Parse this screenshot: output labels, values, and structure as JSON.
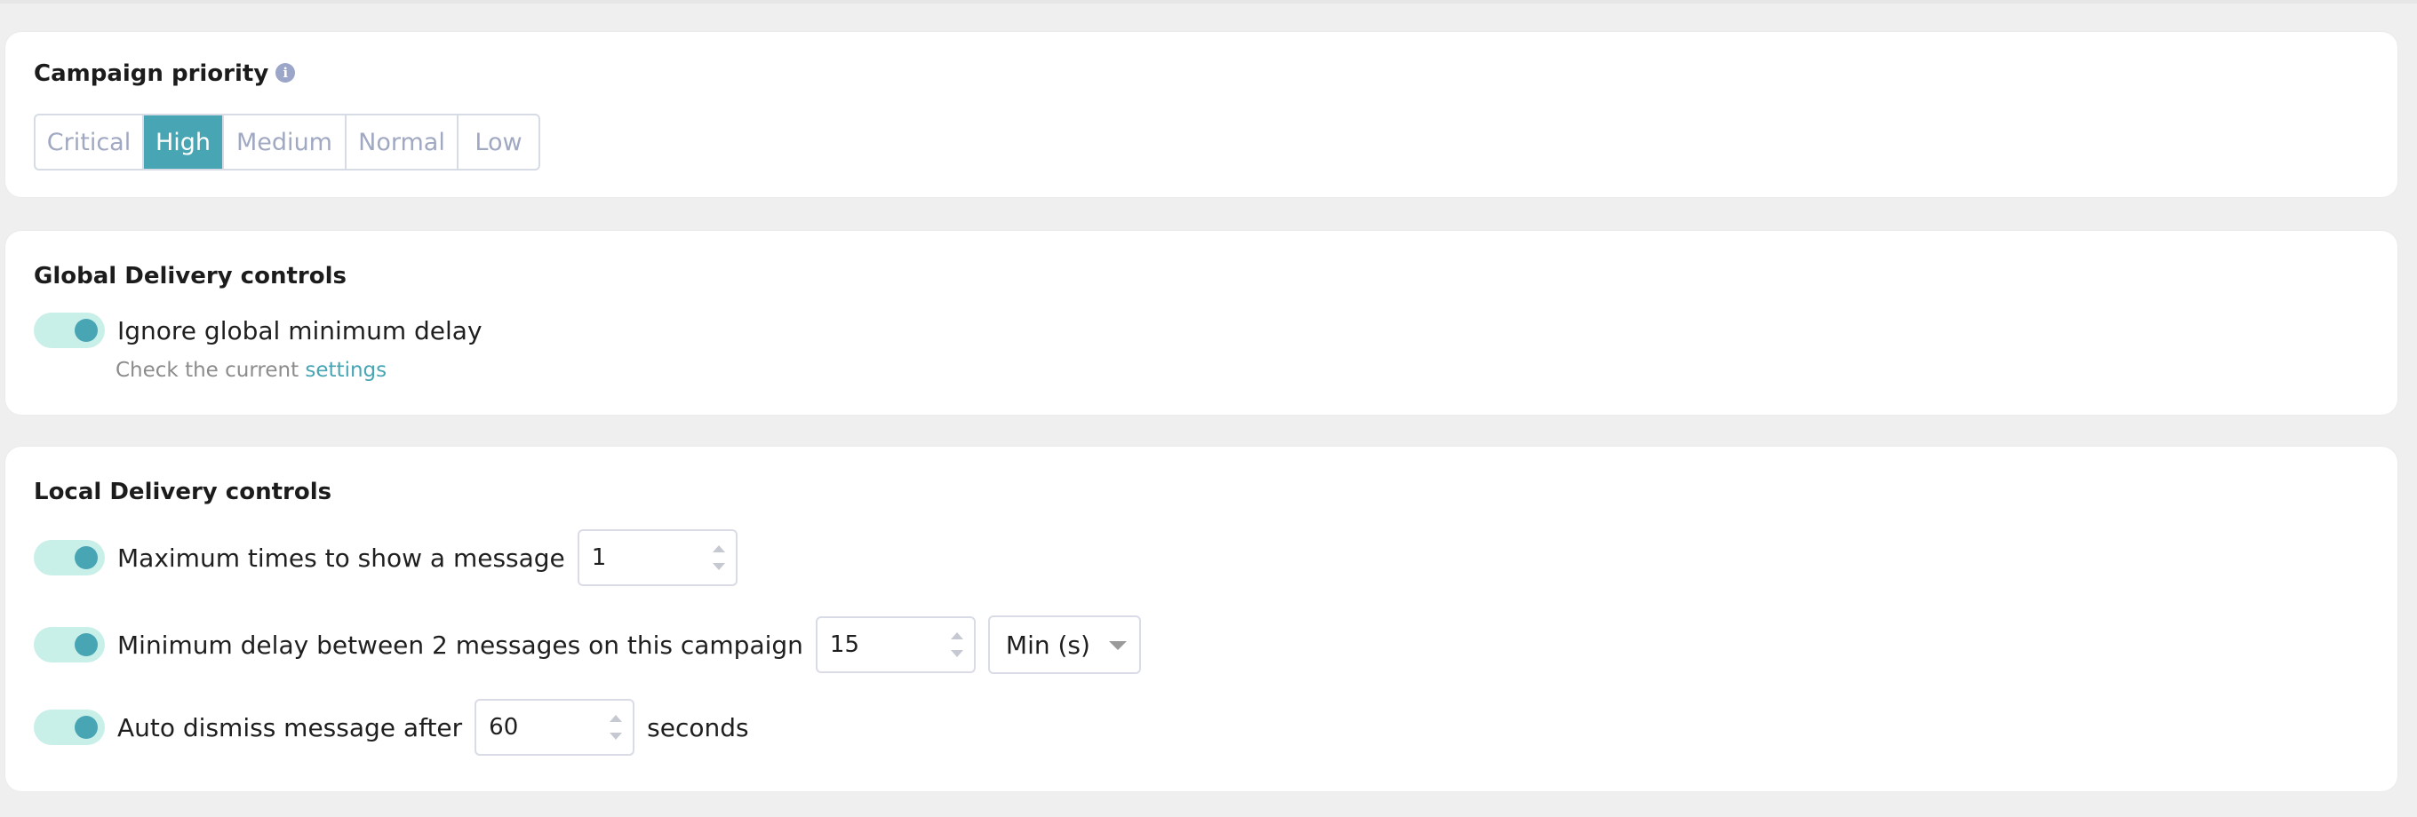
{
  "priority": {
    "title": "Campaign priority",
    "info_glyph": "i",
    "options": [
      "Critical",
      "High",
      "Medium",
      "Normal",
      "Low"
    ],
    "selected": "High"
  },
  "global": {
    "title": "Global Delivery controls",
    "ignore_label": "Ignore global minimum delay",
    "ignore_enabled": true,
    "helper_text": "Check the current ",
    "helper_link": "settings"
  },
  "local": {
    "title": "Local Delivery controls",
    "max_times": {
      "label": "Maximum times to show a message",
      "value": "1",
      "enabled": true
    },
    "min_delay": {
      "label": "Minimum delay between 2 messages on this campaign",
      "value": "15",
      "unit": "Min (s)",
      "enabled": true
    },
    "auto_dismiss": {
      "label": "Auto dismiss message after",
      "value": "60",
      "suffix": "seconds",
      "enabled": true
    }
  },
  "colors": {
    "accent": "#48a6b4",
    "toggle_track": "#c9efe9",
    "muted_text": "#a0a8c2",
    "info_icon": "#9ba6c8"
  }
}
